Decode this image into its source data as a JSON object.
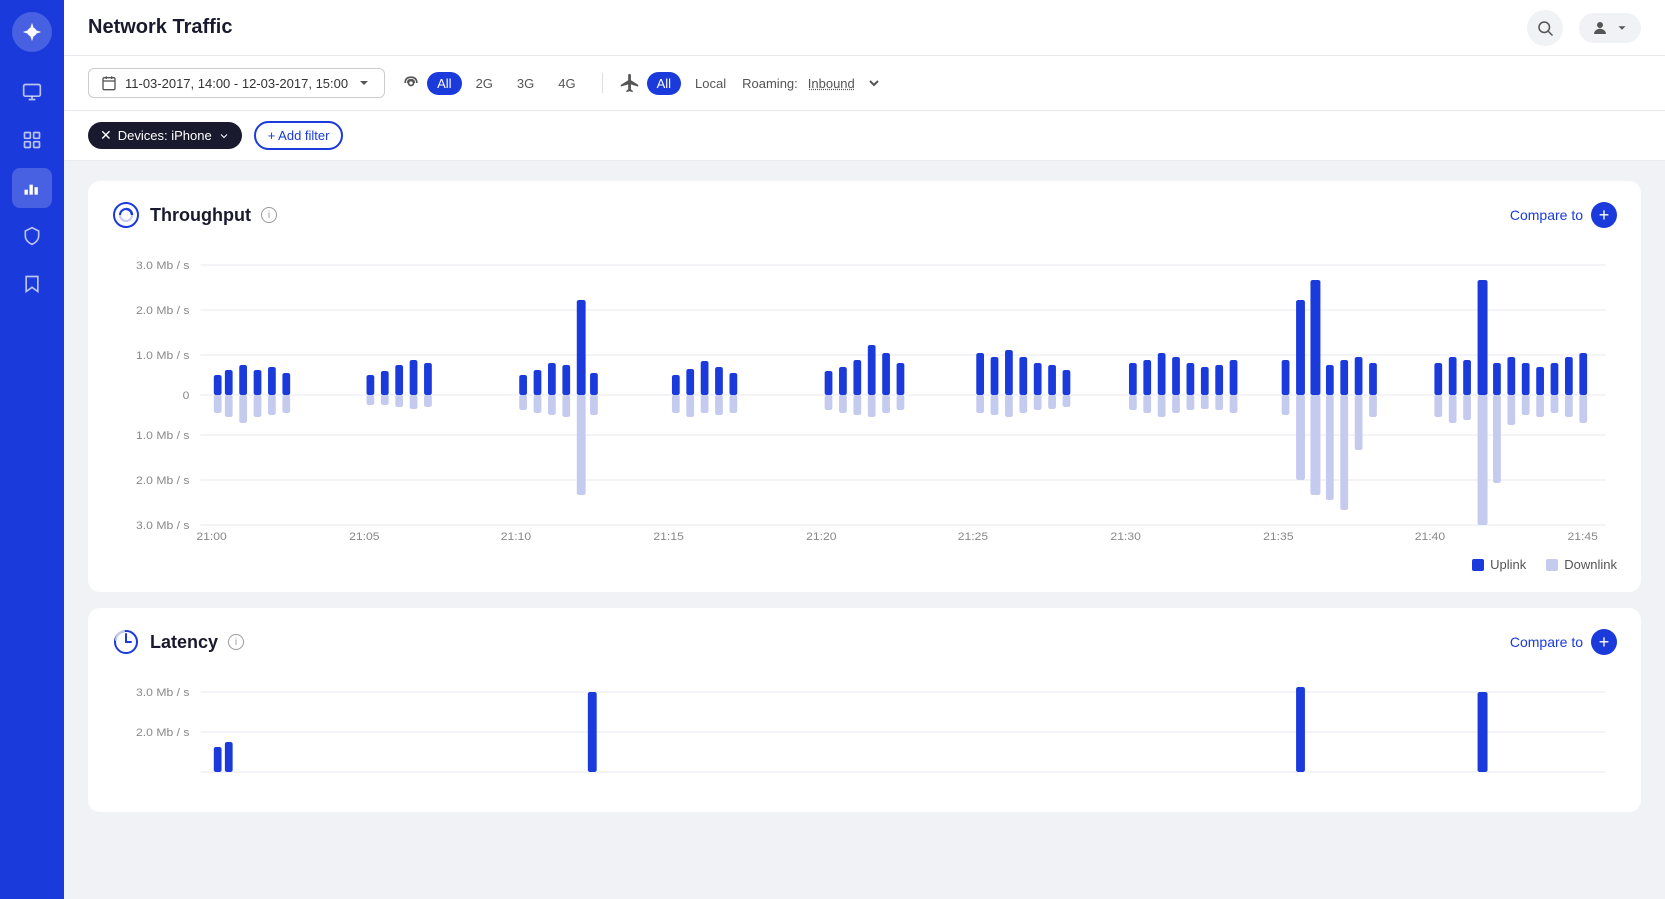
{
  "app": {
    "title": "Network Traffic"
  },
  "topbar": {
    "title": "Network Traffic",
    "search_label": "Search",
    "user_label": "User"
  },
  "filters": {
    "date_range": "11-03-2017, 14:00 - 12-03-2017, 15:00",
    "network_types": [
      "All",
      "2G",
      "3G",
      "4G"
    ],
    "active_network": "All",
    "traffic_types": [
      "All",
      "Local"
    ],
    "active_traffic": "All",
    "roaming_label": "Roaming:",
    "roaming_value": "Inbound",
    "device_filter": "Devices: iPhone",
    "add_filter_label": "+ Add filter"
  },
  "throughput": {
    "title": "Throughput",
    "compare_label": "Compare to",
    "y_labels": [
      "3.0 Mb / s",
      "2.0 Mb / s",
      "1.0 Mb / s",
      "0",
      "1.0 Mb / s",
      "2.0 Mb / s",
      "3.0 Mb / s"
    ],
    "x_labels": [
      "21:00",
      "21:05",
      "21:10",
      "21:15",
      "21:20",
      "21:25",
      "21:30",
      "21:35",
      "21:40",
      "21:45"
    ],
    "legend": {
      "uplink": "Uplink",
      "downlink": "Downlink"
    }
  },
  "latency": {
    "title": "Latency",
    "compare_label": "Compare to",
    "y_labels": [
      "3.0 Mb / s",
      "2.0 Mb / s"
    ]
  },
  "sidebar": {
    "items": [
      {
        "id": "logo",
        "label": "Logo"
      },
      {
        "id": "monitor",
        "label": "Monitor"
      },
      {
        "id": "dashboard",
        "label": "Dashboard"
      },
      {
        "id": "analytics",
        "label": "Analytics",
        "active": true
      },
      {
        "id": "security",
        "label": "Security"
      },
      {
        "id": "bookmarks",
        "label": "Bookmarks"
      }
    ]
  },
  "colors": {
    "primary": "#1a3adb",
    "uplink": "#1a3adb",
    "downlink": "#c5caef",
    "sidebar_bg": "#1a3adb"
  }
}
